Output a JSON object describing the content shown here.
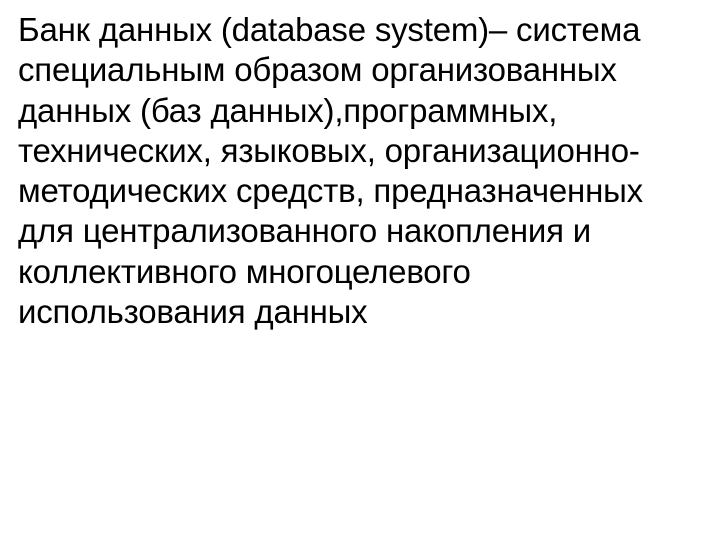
{
  "slide": {
    "definition": "Банк данных (database system)– система специальным образом организованных данных (баз данных),программных, технических, языковых, организационно-методических средств, предназначенных для централизованного накопления и коллективного многоцелевого использования данных"
  }
}
